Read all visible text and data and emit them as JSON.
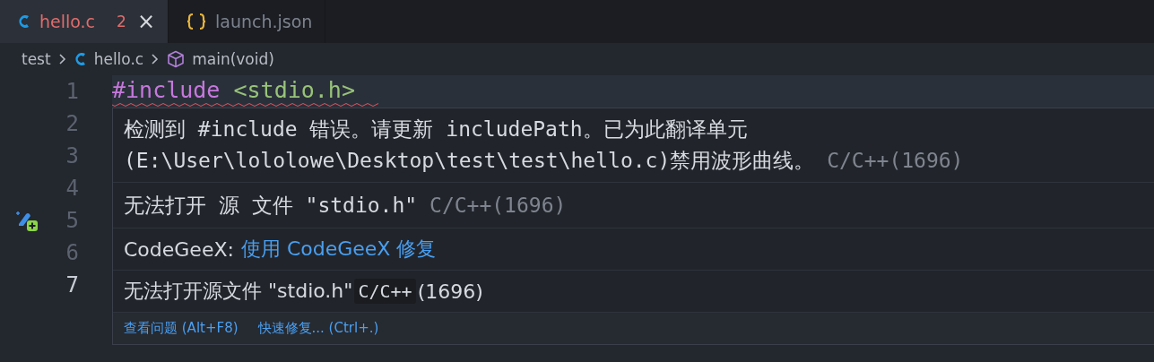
{
  "tabs": [
    {
      "label": "hello.c",
      "kind": "c-file",
      "selected": true,
      "errors": true,
      "badge": "2",
      "close": "×"
    },
    {
      "label": "launch.json",
      "kind": "json-file",
      "selected": false,
      "errors": false
    }
  ],
  "breadcrumb": [
    {
      "label": "test",
      "kind": "folder"
    },
    {
      "label": "hello.c",
      "kind": "c-file"
    },
    {
      "label": "main(void)",
      "kind": "function"
    }
  ],
  "editor": {
    "lines": [
      {
        "number": "1",
        "current": false,
        "squiggle": true,
        "gutter_action": false,
        "tokens": [
          {
            "text": "#include",
            "kind": "keyword"
          },
          {
            "text": "<stdio.h>",
            "kind": "string"
          }
        ]
      },
      {
        "number": "2",
        "current": false,
        "squiggle": false,
        "gutter_action": false
      },
      {
        "number": "3",
        "current": false,
        "squiggle": false,
        "gutter_action": false
      },
      {
        "number": "4",
        "current": false,
        "squiggle": false,
        "gutter_action": false
      },
      {
        "number": "5",
        "current": false,
        "squiggle": false,
        "gutter_action": true
      },
      {
        "number": "6",
        "current": false,
        "squiggle": false,
        "gutter_action": false
      },
      {
        "number": "7",
        "current": true,
        "squiggle": false,
        "gutter_action": false
      }
    ]
  },
  "hover": {
    "messages": [
      {
        "kind": "diagnostic",
        "lines": [
          "检测到 #include 错误。请更新 includePath。已为此翻译单元",
          "(E:\\User\\lololowe\\Desktop\\test\\test\\hello.c)禁用波形曲线。"
        ],
        "source": "C/C++(1696)"
      },
      {
        "kind": "diagnostic",
        "lines": [
          "无法打开 源 文件 \"stdio.h\""
        ],
        "source": "C/C++(1696)"
      },
      {
        "kind": "action",
        "prefix": "CodeGeeX:",
        "link": "使用 CodeGeeX 修复"
      },
      {
        "kind": "plain",
        "text": "无法打开源文件 \"stdio.h\"",
        "code": "C/C++",
        "after": "(1696)"
      }
    ],
    "actions": [
      "查看问题 (Alt+F8)",
      "快速修复... (Ctrl+.)"
    ]
  }
}
